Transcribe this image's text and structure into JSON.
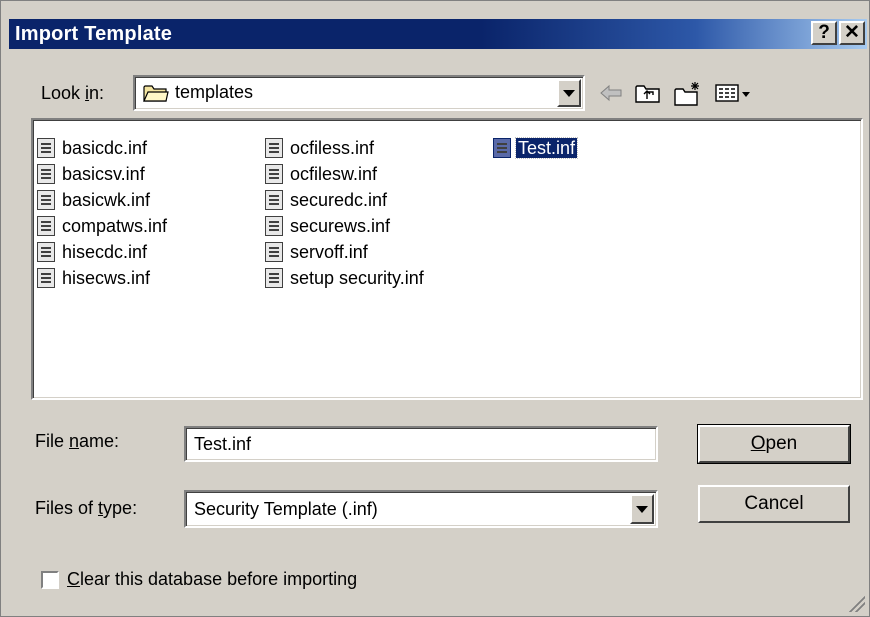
{
  "window": {
    "title": "Import Template",
    "help_button": "?",
    "close_button": "✕"
  },
  "lookin": {
    "label_pre": "Look ",
    "label_hot": "i",
    "label_post": "n:",
    "value": "templates",
    "icons": [
      "back-arrow-icon",
      "up-folder-icon",
      "new-folder-icon",
      "view-menu-icon"
    ]
  },
  "files": {
    "col1": [
      "basicdc.inf",
      "basicsv.inf",
      "basicwk.inf",
      "compatws.inf",
      "hisecdc.inf",
      "hisecws.inf"
    ],
    "col2": [
      "ocfiless.inf",
      "ocfilesw.inf",
      "securedc.inf",
      "securews.inf",
      "servoff.inf",
      "setup security.inf"
    ],
    "col3": [
      "Test.inf"
    ],
    "selected": "Test.inf"
  },
  "filename": {
    "label_pre": "File ",
    "label_hot": "n",
    "label_post": "ame:",
    "value": "Test.inf"
  },
  "filetype": {
    "label_pre": "Files of ",
    "label_hot": "t",
    "label_post": "ype:",
    "value": "Security Template (.inf)"
  },
  "buttons": {
    "open_hot": "O",
    "open_rest": "pen",
    "cancel": "Cancel"
  },
  "checkbox": {
    "hot": "C",
    "rest": "lear this database before importing",
    "checked": false
  }
}
